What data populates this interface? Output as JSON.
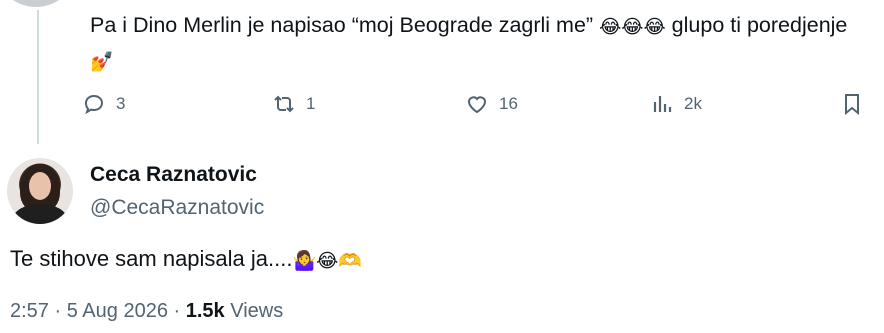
{
  "reply": {
    "text_part1": "Pa i Dino Merlin je napisao “moj Beograde zagrli me”",
    "emoji_1": "😂😂😂",
    "text_part2": "glupo ti poredjenje",
    "emoji_2": "💅",
    "replies": "3",
    "reposts": "1",
    "likes": "16",
    "views": "2k"
  },
  "tweet": {
    "author_name": "Ceca Raznatovic",
    "handle": "@CecaRaznatovic",
    "text": "Te stihove sam napisala ja....",
    "emoji": "🤷‍♀️😂🫶",
    "time": "2:57",
    "separator": "·",
    "date": "5 Aug 2026",
    "views": "1.5k",
    "views_label": "Views"
  },
  "colors": {
    "text": "#0f1419",
    "secondary": "#536471",
    "thread_line": "#cfd9de"
  }
}
